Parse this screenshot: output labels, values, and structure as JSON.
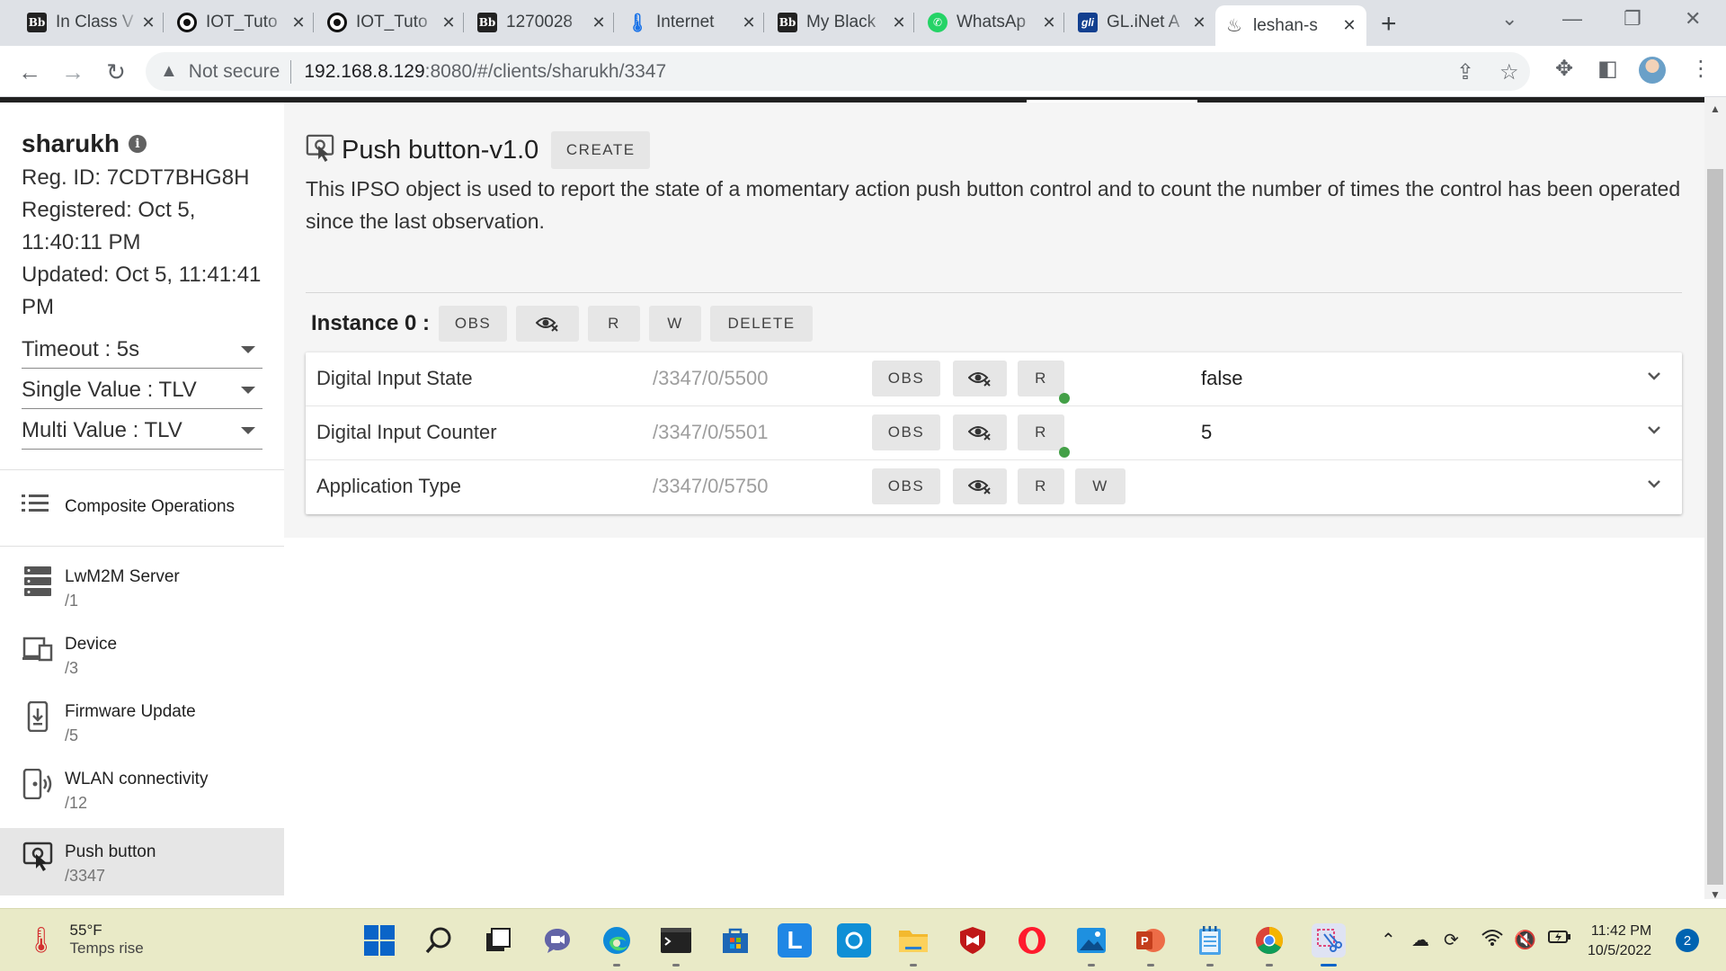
{
  "browser": {
    "tabs": [
      {
        "title": "In Class V",
        "favicon": "blackboard-icon"
      },
      {
        "title": "IOT_Tuto",
        "favicon": "github-icon"
      },
      {
        "title": "IOT_Tuto",
        "favicon": "github-icon"
      },
      {
        "title": "1270028",
        "favicon": "blackboard-icon"
      },
      {
        "title": "Internet",
        "favicon": "internet-icon"
      },
      {
        "title": "My Black",
        "favicon": "blackboard-icon"
      },
      {
        "title": "WhatsAp",
        "favicon": "whatsapp-icon"
      },
      {
        "title": "GL.iNet A",
        "favicon": "glinet-icon"
      },
      {
        "title": "leshan-s",
        "favicon": "leshan-icon",
        "active": true
      }
    ],
    "security_label": "Not secure",
    "url_host": "192.168.8.129",
    "url_path": ":8080/#/clients/sharukh/3347"
  },
  "client": {
    "name": "sharukh",
    "reg_id": "Reg. ID: 7CDT7BHG8H",
    "registered": "Registered: Oct 5, 11:40:11 PM",
    "updated": "Updated: Oct 5, 11:41:41 PM",
    "timeout": "Timeout : 5s",
    "single_value": "Single Value : TLV",
    "multi_value": "Multi Value : TLV"
  },
  "sidebar": {
    "composite_operations": "Composite Operations",
    "objects": [
      {
        "label": "LwM2M Server",
        "path": "/1",
        "icon": "server-icon"
      },
      {
        "label": "Device",
        "path": "/3",
        "icon": "device-icon"
      },
      {
        "label": "Firmware Update",
        "path": "/5",
        "icon": "firmware-icon"
      },
      {
        "label": "WLAN connectivity",
        "path": "/12",
        "icon": "wlan-icon"
      },
      {
        "label": "Push button",
        "path": "/3347",
        "icon": "push-button-icon",
        "selected": true
      }
    ]
  },
  "object": {
    "title": "Push button-v1.0",
    "create_label": "CREATE",
    "description": "This IPSO object is used to report the state of a momentary action push button control and to count the number of times the control has been operated since the last observation."
  },
  "instance": {
    "label": "Instance 0 :",
    "obs_label": "OBS",
    "r_label": "R",
    "w_label": "W",
    "delete_label": "DELETE"
  },
  "resources": [
    {
      "name": "Digital Input State",
      "path": "/3347/0/5500",
      "value": "false",
      "writable": false,
      "observed": true
    },
    {
      "name": "Digital Input Counter",
      "path": "/3347/0/5501",
      "value": "5",
      "writable": false,
      "observed": true
    },
    {
      "name": "Application Type",
      "path": "/3347/0/5750",
      "value": "",
      "writable": true,
      "observed": false
    }
  ],
  "resource_buttons": {
    "obs": "OBS",
    "r": "R",
    "w": "W"
  },
  "taskbar": {
    "weather_temp": "55°F",
    "weather_desc": "Temps rise",
    "time": "11:42 PM",
    "date": "10/5/2022",
    "notifications": "2"
  },
  "colors": {
    "accent": "#43a047",
    "app_bar": "#212121",
    "taskbar": "#e9eac7"
  }
}
